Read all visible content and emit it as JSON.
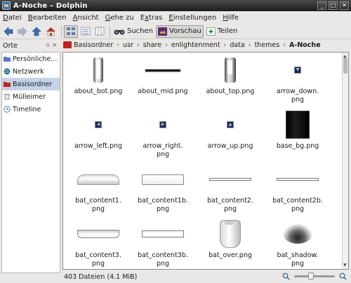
{
  "window": {
    "title": "A-Noche – Dolphin"
  },
  "menu": [
    {
      "pre": "",
      "key": "D",
      "post": "atei"
    },
    {
      "pre": "",
      "key": "B",
      "post": "earbeiten"
    },
    {
      "pre": "",
      "key": "A",
      "post": "nsicht"
    },
    {
      "pre": "",
      "key": "G",
      "post": "ehe zu"
    },
    {
      "pre": "E",
      "key": "x",
      "post": "tras"
    },
    {
      "pre": "",
      "key": "E",
      "post": "instellungen"
    },
    {
      "pre": "",
      "key": "H",
      "post": "ilfe"
    }
  ],
  "toolbar": {
    "search_label": "Suchen",
    "preview_label": "Vorschau",
    "split_label": "Teilen"
  },
  "sidebar": {
    "header": "Orte",
    "items": [
      {
        "label": "Persönliche...",
        "icon": "folder-icon"
      },
      {
        "label": "Netzwerk",
        "icon": "network-icon"
      },
      {
        "label": "Basisordner",
        "icon": "home-icon"
      },
      {
        "label": "Mülleimer",
        "icon": "trash-icon"
      },
      {
        "label": "Timeline",
        "icon": "timeline-icon"
      }
    ]
  },
  "breadcrumb": {
    "segments": [
      "Basisordner",
      "usr",
      "share",
      "enlightenment",
      "data",
      "themes"
    ],
    "current": "A-Noche"
  },
  "files": [
    {
      "name": "about_bot.png",
      "thumb": "bot"
    },
    {
      "name": "about_mid.png",
      "thumb": "mid"
    },
    {
      "name": "about_top.png",
      "thumb": "top"
    },
    {
      "name": "arrow_down.\npng",
      "thumb": "adown"
    },
    {
      "name": "arrow_left.png",
      "thumb": "aleft"
    },
    {
      "name": "arrow_right.\npng",
      "thumb": "aright"
    },
    {
      "name": "arrow_up.png",
      "thumb": "aup"
    },
    {
      "name": "base_bg.png",
      "thumb": "basebg"
    },
    {
      "name": "bat_content1.\npng",
      "thumb": "bc1"
    },
    {
      "name": "bat_content1b.\npng",
      "thumb": "bc1b"
    },
    {
      "name": "bat_content2.\npng",
      "thumb": "bc2"
    },
    {
      "name": "bat_content2b.\npng",
      "thumb": "bc2b"
    },
    {
      "name": "bat_content3.\npng",
      "thumb": "bc3"
    },
    {
      "name": "bat_content3b.\npng",
      "thumb": "bc3b"
    },
    {
      "name": "bat_over.png",
      "thumb": "over"
    },
    {
      "name": "bat_shadow.\npng",
      "thumb": "shadow"
    }
  ],
  "status": {
    "text": "403 Dateien (4.1 MiB)",
    "zoom_level": 0.4
  },
  "colors": {
    "selection": "#c3d3e8",
    "home_folder": "#c8201f"
  }
}
